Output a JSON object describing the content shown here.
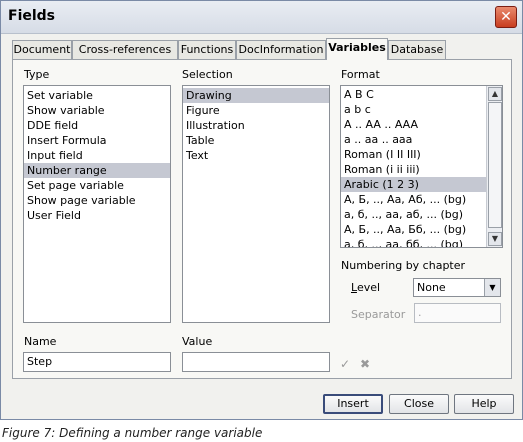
{
  "dialog": {
    "title": "Fields",
    "close_glyph": "✕"
  },
  "tabs": [
    "Document",
    "Cross-references",
    "Functions",
    "DocInformation",
    "Variables",
    "Database"
  ],
  "active_tab": "Variables",
  "type": {
    "label": "Type",
    "items": [
      "Set variable",
      "Show variable",
      "DDE field",
      "Insert Formula",
      "Input field",
      "Number range",
      "Set page variable",
      "Show page variable",
      "User Field"
    ],
    "selected": "Number range"
  },
  "selection": {
    "label": "Selection",
    "items": [
      "Drawing",
      "Figure",
      "Illustration",
      "Table",
      "Text"
    ],
    "selected": "Drawing"
  },
  "format": {
    "label": "Format",
    "items": [
      "A B C",
      "a b c",
      "A .. AA .. AAA",
      "a .. aa .. aaa",
      "Roman (I II III)",
      "Roman (i ii iii)",
      "Arabic (1 2 3)",
      "A, Б, .., Aa, Аб, ... (bg)",
      "a, б, .., aa, аб, ... (bg)",
      "A, Б, .., Aa, Бб, ... (bg)",
      "a, б, .., aa, бб, ... (bg)"
    ],
    "selected": "Arabic (1 2 3)"
  },
  "numbering": {
    "label": "Numbering by chapter",
    "level_label": "Level",
    "level_value": "None",
    "separator_label": "Separator",
    "separator_value": "."
  },
  "name": {
    "label": "Name",
    "value": "Step"
  },
  "value": {
    "label": "Value",
    "value": ""
  },
  "icons": {
    "apply": "✓",
    "delete": "✖"
  },
  "buttons": {
    "insert": "Insert",
    "close": "Close",
    "help": "Help"
  },
  "caption": "Figure 7: Defining a number range variable"
}
